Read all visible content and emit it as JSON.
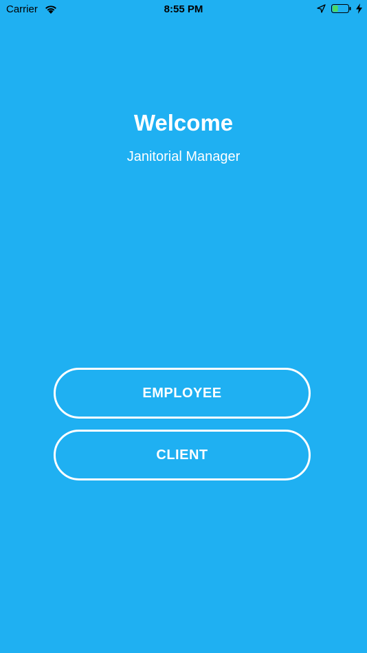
{
  "status_bar": {
    "carrier": "Carrier",
    "time": "8:55 PM",
    "battery_level": 0.35,
    "battery_color": "#4CD964"
  },
  "main": {
    "title": "Welcome",
    "subtitle": "Janitorial Manager",
    "employee_label": "EMPLOYEE",
    "client_label": "CLIENT"
  },
  "colors": {
    "background": "#1FB0F2",
    "text": "#FFFFFF"
  }
}
